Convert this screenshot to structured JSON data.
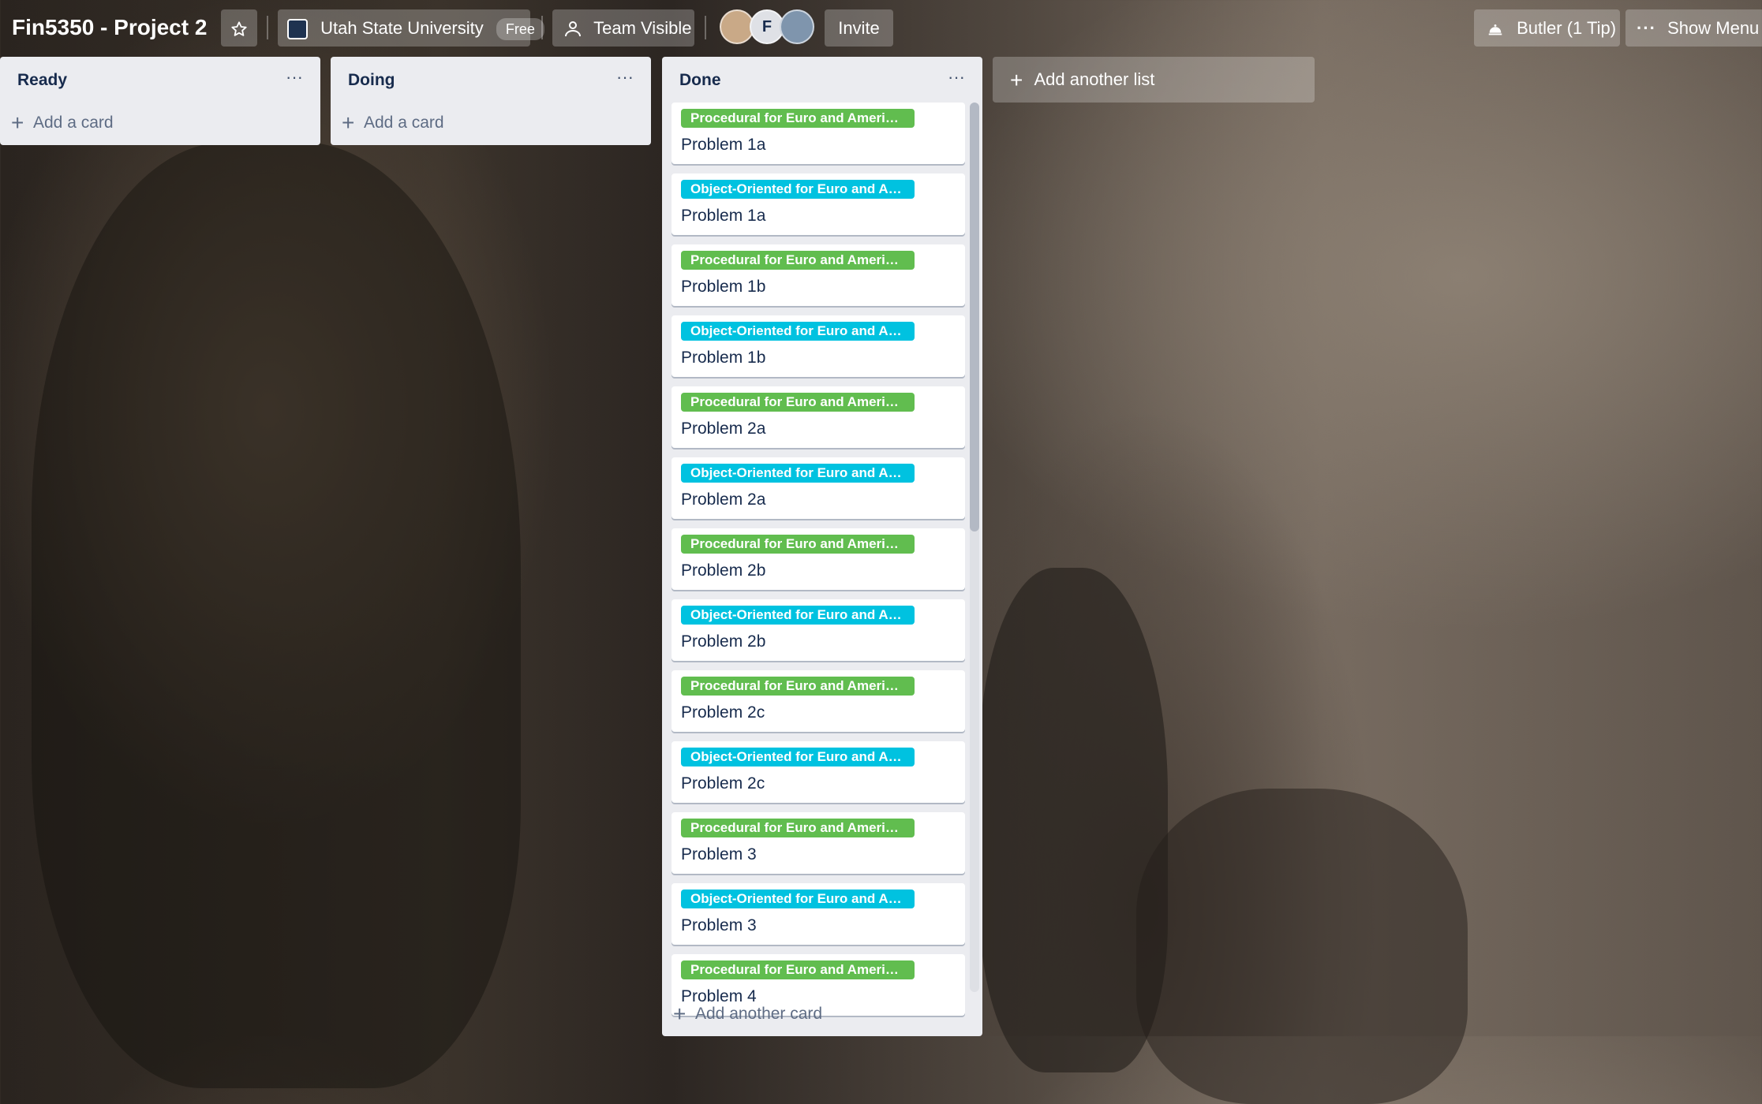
{
  "header": {
    "board_title": "Fin5350 - Project 2",
    "workspace": "Utah State University",
    "workspace_badge": "Free",
    "visibility": "Team Visible",
    "invite": "Invite",
    "avatar_initial": "F",
    "butler": "Butler (1 Tip)",
    "show_menu": "Show Menu"
  },
  "lists": {
    "ready": {
      "title": "Ready",
      "add_card": "Add a card"
    },
    "doing": {
      "title": "Doing",
      "add_card": "Add a card"
    },
    "done": {
      "title": "Done",
      "add_card": "Add another card",
      "cards": [
        {
          "label": "Procedural for Euro and American",
          "label_color": "#61bd4f",
          "title": "Problem 1a"
        },
        {
          "label": "Object-Oriented for Euro and Am...",
          "label_color": "#00c2e0",
          "title": "Problem 1a"
        },
        {
          "label": "Procedural for Euro and American",
          "label_color": "#61bd4f",
          "title": "Problem 1b"
        },
        {
          "label": "Object-Oriented for Euro and Am...",
          "label_color": "#00c2e0",
          "title": "Problem 1b"
        },
        {
          "label": "Procedural for Euro and American",
          "label_color": "#61bd4f",
          "title": "Problem 2a"
        },
        {
          "label": "Object-Oriented for Euro and Am...",
          "label_color": "#00c2e0",
          "title": "Problem 2a"
        },
        {
          "label": "Procedural for Euro and American",
          "label_color": "#61bd4f",
          "title": "Problem 2b"
        },
        {
          "label": "Object-Oriented for Euro and Am...",
          "label_color": "#00c2e0",
          "title": "Problem 2b"
        },
        {
          "label": "Procedural for Euro and American",
          "label_color": "#61bd4f",
          "title": "Problem 2c"
        },
        {
          "label": "Object-Oriented for Euro and Am...",
          "label_color": "#00c2e0",
          "title": "Problem 2c"
        },
        {
          "label": "Procedural for Euro and American",
          "label_color": "#61bd4f",
          "title": "Problem 3"
        },
        {
          "label": "Object-Oriented for Euro and Am...",
          "label_color": "#00c2e0",
          "title": "Problem 3"
        },
        {
          "label": "Procedural for Euro and American",
          "label_color": "#61bd4f",
          "title": "Problem 4"
        }
      ]
    }
  },
  "add_list": "Add another list"
}
